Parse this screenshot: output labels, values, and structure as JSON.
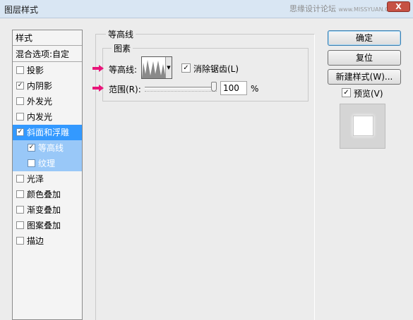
{
  "window": {
    "title": "图层样式",
    "watermark": "思缘设计论坛",
    "watermark_url": "www.MISSYUAN.COM",
    "close_glyph": "X"
  },
  "style_list": {
    "header": "样式",
    "blend_options": "混合选项:自定",
    "items": [
      {
        "label": "投影",
        "checked": false
      },
      {
        "label": "内阴影",
        "checked": true
      },
      {
        "label": "外发光",
        "checked": false
      },
      {
        "label": "内发光",
        "checked": false
      },
      {
        "label": "斜面和浮雕",
        "checked": true,
        "selected": true
      },
      {
        "label": "等高线",
        "checked": true,
        "sub": true
      },
      {
        "label": "纹理",
        "checked": false,
        "sub": true
      },
      {
        "label": "光泽",
        "checked": false
      },
      {
        "label": "颜色叠加",
        "checked": false
      },
      {
        "label": "渐变叠加",
        "checked": false
      },
      {
        "label": "图案叠加",
        "checked": false
      },
      {
        "label": "描边",
        "checked": false
      }
    ]
  },
  "contour_panel": {
    "group_title": "等高线",
    "subgroup_title": "图素",
    "contour_label": "等高线:",
    "anti_alias_label": "消除锯齿(L)",
    "anti_alias_checked": true,
    "range_label": "范围(R):",
    "range_value": "100",
    "range_unit": "%",
    "range_percent": 100
  },
  "buttons": {
    "ok": "确定",
    "reset": "复位",
    "new_style": "新建样式(W)...",
    "preview_label": "预览(V)",
    "preview_checked": true
  },
  "colors": {
    "accent_selected": "#3399ff",
    "sub_selected": "#99c8f8",
    "arrow": "#e8157a"
  },
  "check_glyph": "✓"
}
